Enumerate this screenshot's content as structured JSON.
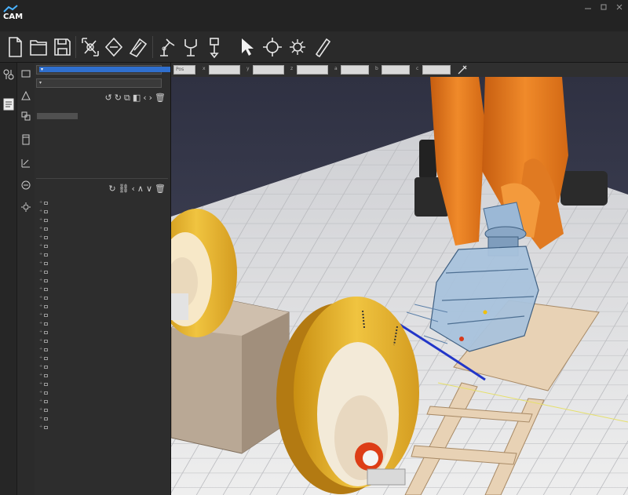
{
  "app": {
    "logo_text": "CAM",
    "title": "                ",
    "menu": [
      "",
      "",
      "",
      "",
      ""
    ]
  },
  "toolbar": {
    "buttons": [
      {
        "name": "new-file-icon"
      },
      {
        "name": "open-file-icon"
      },
      {
        "name": "save-file-icon"
      },
      {
        "name": "transform-icon"
      },
      {
        "name": "rotate-left-icon"
      },
      {
        "name": "rotate-right-icon"
      },
      {
        "name": "robot-arm-icon"
      },
      {
        "name": "gripper-icon"
      },
      {
        "name": "tool-icon"
      },
      {
        "name": "select-cursor-icon"
      },
      {
        "name": "target-frame-icon"
      },
      {
        "name": "calibrate-icon"
      },
      {
        "name": "pen-icon"
      }
    ]
  },
  "viewport_toolbar": {
    "mode_value": "Pos",
    "fields": [
      "",
      "",
      "",
      "",
      "",
      "",
      ""
    ]
  },
  "panel": {
    "object_combo": "",
    "layer_combo": "",
    "props": [
      {
        "k": "",
        "v1": "",
        "v2": ""
      },
      {
        "k": "",
        "v1": "",
        "v2": ""
      }
    ],
    "tree_items": [
      "",
      "",
      "",
      "",
      "",
      "",
      "",
      "",
      "",
      "",
      "",
      "",
      "",
      "",
      "",
      "",
      "",
      "",
      "",
      "",
      "",
      "",
      "",
      "",
      "",
      "",
      ""
    ],
    "selected_index": 11
  },
  "colors": {
    "robot": "#e07a22",
    "wheel": "#e3b02a",
    "floor": "#e8e8e8",
    "sky": "#3c3f55",
    "accent_blue": "#2f6fce"
  }
}
